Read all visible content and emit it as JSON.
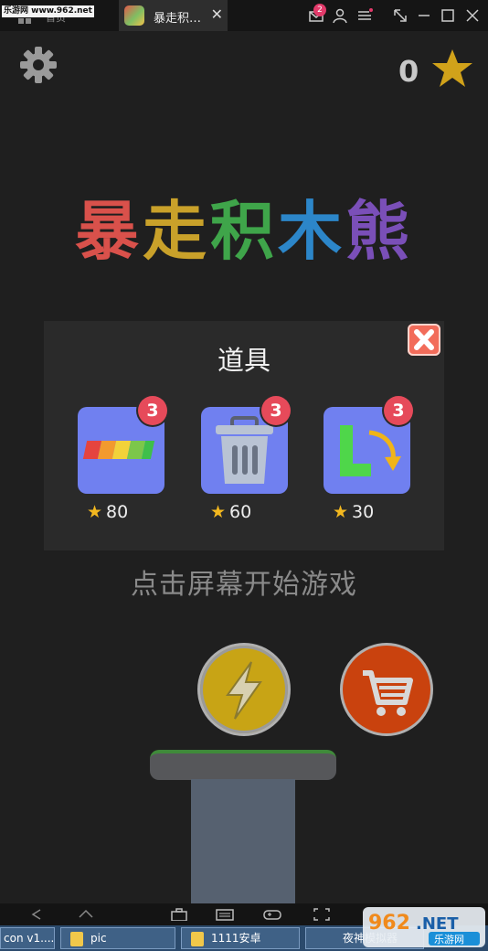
{
  "browser": {
    "watermark": "乐游网 www.962.net",
    "home_label": "首页",
    "tab_title": "暴走积…",
    "tab_close": "✕",
    "notification_count": "2"
  },
  "game": {
    "score": "0",
    "title_chars": [
      "暴",
      "走",
      "积",
      "木",
      "熊"
    ],
    "props_panel": {
      "title": "道具",
      "items": [
        {
          "name": "rainbow-bar",
          "count": "3",
          "price": "80"
        },
        {
          "name": "trash",
          "count": "3",
          "price": "60"
        },
        {
          "name": "rotate-l",
          "count": "3",
          "price": "30"
        }
      ]
    },
    "tap_to_start": "点击屏幕开始游戏"
  },
  "taskbar": {
    "items": [
      "con v1....",
      "pic",
      "1111安卓",
      "夜神模拟器"
    ],
    "logo_text": "962.NET",
    "logo_sub": "乐游网"
  },
  "colors": {
    "background": "#1f1f1f",
    "panel": "#2a2a2a",
    "item_card": "#7080f0",
    "badge": "#e64a5a",
    "bolt_button": "#c8a415",
    "cart_button": "#c9420e",
    "close_button": "#f26c5a"
  }
}
